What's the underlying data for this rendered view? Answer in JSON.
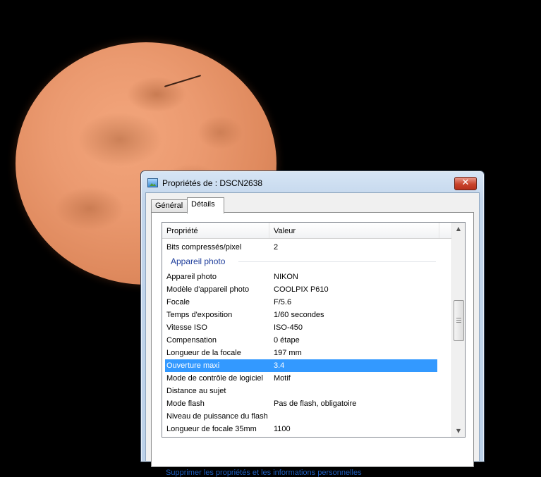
{
  "window": {
    "title": "Propriétés de : DSCN2638",
    "close_label": "✕"
  },
  "tabs": [
    {
      "label": "Général"
    },
    {
      "label": "Détails"
    }
  ],
  "columns": {
    "property": "Propriété",
    "value": "Valeur"
  },
  "rows_top": [
    {
      "property": "Bits compressés/pixel",
      "value": "2"
    }
  ],
  "group": {
    "label": "Appareil photo"
  },
  "rows": [
    {
      "property": "Appareil photo",
      "value": "NIKON"
    },
    {
      "property": "Modèle d'appareil photo",
      "value": "COOLPIX P610"
    },
    {
      "property": "Focale",
      "value": "F/5.6"
    },
    {
      "property": "Temps d'exposition",
      "value": "1/60 secondes"
    },
    {
      "property": "Vitesse ISO",
      "value": "ISO-450"
    },
    {
      "property": "Compensation",
      "value": "0 étape"
    },
    {
      "property": "Longueur de la focale",
      "value": "197 mm"
    },
    {
      "property": "Ouverture maxi",
      "value": "3.4"
    },
    {
      "property": "Mode de contrôle de logiciel",
      "value": "Motif"
    },
    {
      "property": "Distance au sujet",
      "value": ""
    },
    {
      "property": "Mode flash",
      "value": "Pas de flash, obligatoire"
    },
    {
      "property": "Niveau de puissance du flash",
      "value": ""
    },
    {
      "property": "Longueur de focale 35mm",
      "value": "1100"
    }
  ],
  "selected_row": "Ouverture maxi",
  "footer": {
    "remove_link": "Supprimer les propriétés et les informations personnelles"
  },
  "colors": {
    "selection": "#3399ff",
    "group_header": "#1e3d9b",
    "link": "#1f5fbf"
  }
}
